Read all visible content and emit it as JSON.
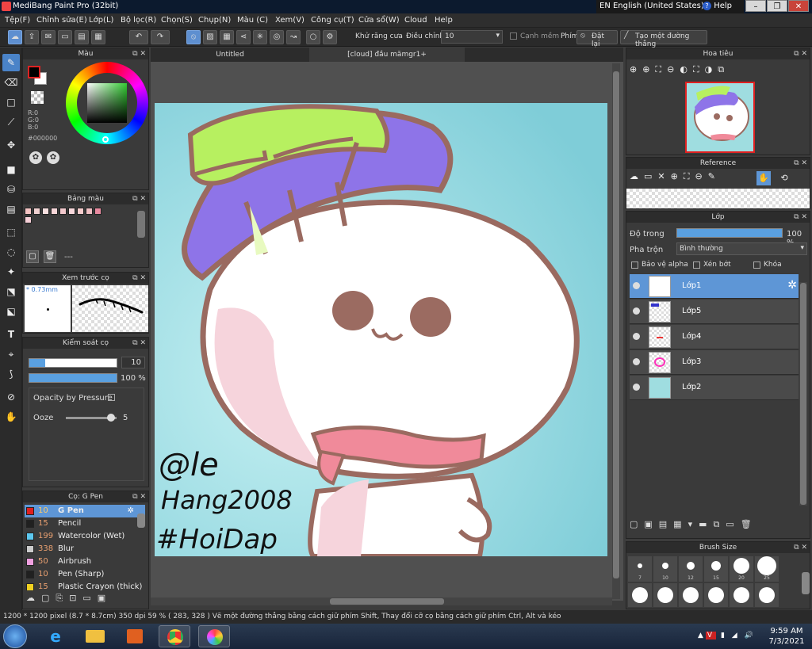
{
  "window": {
    "title": "MediBang Paint Pro (32bit)",
    "language": "EN English (United States)",
    "help": "Help",
    "controls": [
      "–",
      "❐",
      "✕"
    ]
  },
  "menu": [
    "Tệp(F)",
    "Chỉnh sửa(E)",
    "Lớp(L)",
    "Bộ lọc(R)",
    "Chọn(S)",
    "Chụp(N)",
    "Màu (C)",
    "Xem(V)",
    "Công cụ(T)",
    "Cửa sổ(W)",
    "Cloud",
    "Help"
  ],
  "toolbar": {
    "antialias_label": "Khử răng cưa",
    "adjust_label": "Điều chỉnh",
    "adjust_value": "10",
    "soft_edge_label": "Cạnh mềm",
    "keys_label": "Phím",
    "reset_label": "Đặt lại",
    "create_line_label": "Tạo một đường thẳng"
  },
  "tabs": [
    "Untitled",
    "[cloud] đầu mămgr1+"
  ],
  "color_panel": {
    "title": "Màu",
    "rgb": [
      "R:0",
      "G:0",
      "B:0"
    ],
    "hex": "#000000",
    "fg": "#000000",
    "bg": "#ffffff"
  },
  "palette_panel": {
    "title": "Bảng màu",
    "swatches": [
      "#f4c4c4",
      "#f0d0d0",
      "#f8e0e0",
      "#f6d6d8",
      "#f2c8cc",
      "#f8d8dc",
      "#f4cccc",
      "#f0c0c4",
      "#e88aa0",
      "#f6d0d8"
    ],
    "more": "---"
  },
  "preview_panel": {
    "title": "Xem trước cọ",
    "size": "0.73mm"
  },
  "brush_control_panel": {
    "title": "Kiểm soát cọ",
    "size_value": "10",
    "opacity_value": "100 %",
    "opacity_pressure_label": "Opacity by Pressure",
    "ooze_label": "Ooze",
    "ooze_value": "5"
  },
  "brush_panel": {
    "title": "Cọ: G Pen",
    "brushes": [
      {
        "size": "10",
        "name": "G Pen",
        "color": "#e02020"
      },
      {
        "size": "15",
        "name": "Pencil",
        "color": "#202020"
      },
      {
        "size": "199",
        "name": "Watercolor (Wet)",
        "color": "#5cc8f0"
      },
      {
        "size": "338",
        "name": "Blur",
        "color": "#cccccc"
      },
      {
        "size": "50",
        "name": "Airbrush",
        "color": "#f0a0e0"
      },
      {
        "size": "10",
        "name": "Pen (Sharp)",
        "color": "#202020"
      },
      {
        "size": "15",
        "name": "Plastic Crayon (thick)",
        "color": "#f0d020"
      }
    ]
  },
  "navigator_panel": {
    "title": "Hoa tiêu"
  },
  "reference_panel": {
    "title": "Reference"
  },
  "layer_panel": {
    "title": "Lớp",
    "opacity_label": "Độ trong",
    "opacity_value": "100 %",
    "blend_label": "Pha trộn",
    "blend_value": "Bình thường",
    "protect_alpha": "Bảo vệ alpha",
    "clipping": "Xén bớt",
    "lock": "Khóa",
    "layers": [
      "Lớp1",
      "Lớp5",
      "Lớp4",
      "Lớp3",
      "Lớp2"
    ]
  },
  "brush_size_panel": {
    "title": "Brush Size",
    "sizes": [
      "7",
      "10",
      "12",
      "15",
      "20",
      "25"
    ]
  },
  "artwork": {
    "signature_lines": [
      "@le",
      "Hang2008",
      "#HoiDap"
    ]
  },
  "status": {
    "text": "1200 * 1200 pixel   (8.7 * 8.7cm)   350 dpi   59 %   ( 283, 328 )   Vẽ một đường thẳng bằng cách giữ phím Shift, Thay đổi cỡ cọ bằng cách giữ phím Ctrl, Alt và kéo"
  },
  "taskbar": {
    "time": "9:59 AM",
    "date": "7/3/2021"
  }
}
